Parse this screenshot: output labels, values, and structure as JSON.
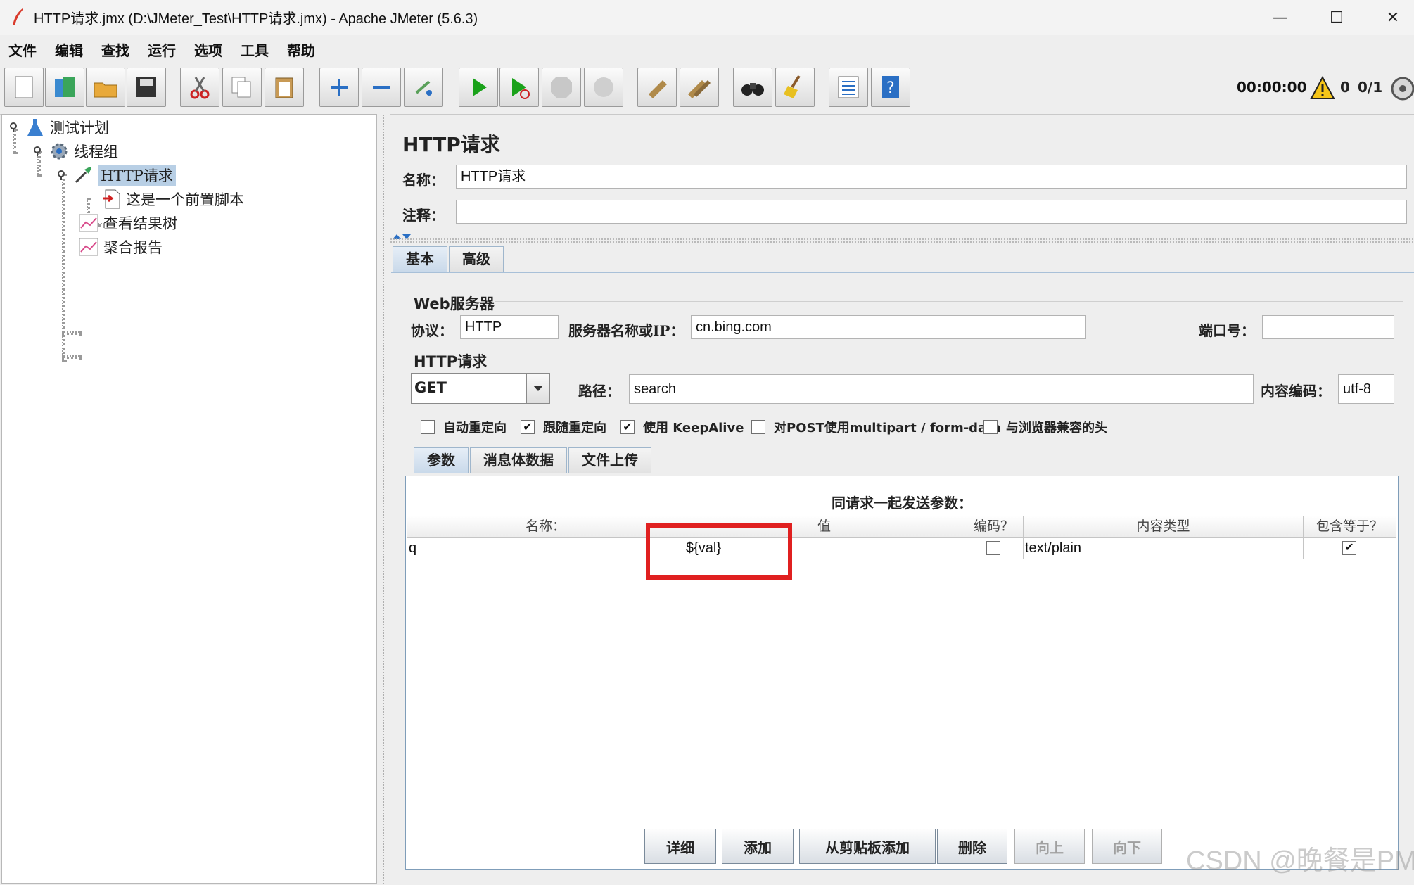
{
  "window": {
    "title": "HTTP请求.jmx (D:\\JMeter_Test\\HTTP请求.jmx) - Apache JMeter (5.6.3)",
    "minimize": "—",
    "maximize": "☐",
    "close": "✕"
  },
  "menu": [
    "文件",
    "编辑",
    "查找",
    "运行",
    "选项",
    "工具",
    "帮助"
  ],
  "toolbar": {
    "timer": "00:00:00",
    "warning_count": "0",
    "thread_count": "0/1",
    "buttons": [
      "new-icon",
      "templates-icon",
      "open-icon",
      "save-icon",
      "cut-icon",
      "copy-icon",
      "paste-icon",
      "expand-icon",
      "collapse-icon",
      "toggle-icon",
      "start-icon",
      "start-no-pause-icon",
      "stop-icon",
      "shutdown-icon",
      "clear-icon",
      "clear-all-icon",
      "search-icon",
      "reset-search-icon",
      "function-helper-icon",
      "help-icon"
    ]
  },
  "tree": {
    "items": [
      {
        "label": "测试计划"
      },
      {
        "label": "线程组"
      },
      {
        "label": "HTTP请求"
      },
      {
        "label": "这是一个前置脚本"
      },
      {
        "label": "查看结果树"
      },
      {
        "label": "聚合报告"
      }
    ]
  },
  "sampler": {
    "heading": "HTTP请求",
    "name_label": "名称：",
    "name_value": "HTTP请求",
    "comment_label": "注释：",
    "comment_value": "",
    "tabs": [
      "基本",
      "高级"
    ],
    "web_server": {
      "title": "Web服务器",
      "protocol_label": "协议：",
      "protocol_value": "HTTP",
      "server_label": "服务器名称或IP：",
      "server_value": "cn.bing.com",
      "port_label": "端口号：",
      "port_value": ""
    },
    "http_request": {
      "title": "HTTP请求",
      "method": "GET",
      "path_label": "路径：",
      "path_value": "search",
      "encoding_label": "内容编码：",
      "encoding_value": "utf-8"
    },
    "options": [
      {
        "label": "自动重定向",
        "checked": false
      },
      {
        "label": "跟随重定向",
        "checked": true
      },
      {
        "label": "使用 KeepAlive",
        "checked": true
      },
      {
        "label": "对POST使用multipart / form-data",
        "checked": false
      },
      {
        "label": "与浏览器兼容的头",
        "checked": false
      }
    ],
    "param_tabs": [
      "参数",
      "消息体数据",
      "文件上传"
    ],
    "params_caption": "同请求一起发送参数：",
    "params_headers": [
      "名称：",
      "值",
      "编码？",
      "内容类型",
      "包含等于？"
    ],
    "params_rows": [
      {
        "name": "q",
        "value": "${val}",
        "encode": false,
        "content_type": "text/plain",
        "include_equals": true
      }
    ],
    "param_buttons": [
      {
        "label": "详细",
        "enabled": true
      },
      {
        "label": "添加",
        "enabled": true
      },
      {
        "label": "从剪贴板添加",
        "enabled": true
      },
      {
        "label": "删除",
        "enabled": true
      },
      {
        "label": "向上",
        "enabled": false
      },
      {
        "label": "向下",
        "enabled": false
      }
    ]
  },
  "watermark": "CSDN @晚餐是PM",
  "colors": {
    "accent": "#b8cfe5",
    "highlight_box": "#e02020"
  }
}
